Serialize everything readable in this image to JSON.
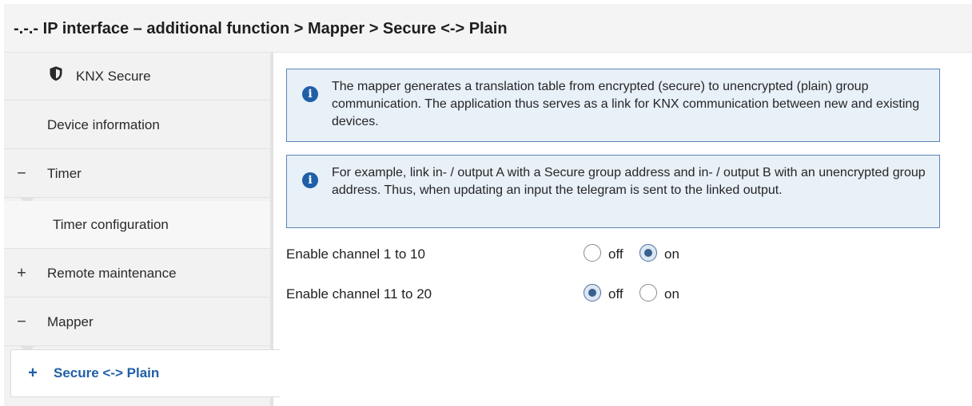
{
  "title": "-.-.- IP interface – additional function > Mapper > Secure <-> Plain",
  "sidebar": {
    "items": [
      {
        "label": "KNX Secure",
        "icon": "shield-icon"
      },
      {
        "label": "Device information"
      },
      {
        "label": "Timer",
        "sign": "−"
      },
      {
        "label": "Timer configuration"
      },
      {
        "label": "Remote maintenance",
        "sign": "+"
      },
      {
        "label": "Mapper",
        "sign": "−"
      },
      {
        "label": "Secure <-> Plain",
        "sign": "+",
        "active": true
      }
    ]
  },
  "info": [
    {
      "icon": "info-icon",
      "text": "The mapper generates a translation table from encrypted (secure) to unencrypted (plain) group communication. The application thus serves as a link for KNX communication between new and existing devices."
    },
    {
      "icon": "info-icon",
      "text": "For example, link in- / output A with a Secure group address and in- / output B with an unencrypted group address. Thus, when updating an input the telegram is sent to the linked output."
    }
  ],
  "params": [
    {
      "label": "Enable channel 1 to 10",
      "options": [
        "off",
        "on"
      ],
      "selected": "on"
    },
    {
      "label": "Enable channel 11 to 20",
      "options": [
        "off",
        "on"
      ],
      "selected": "off"
    }
  ],
  "colors": {
    "accent": "#1f5fa8",
    "info_bg": "#e8f0f8",
    "info_border": "#5a86b8",
    "sidebar_bg": "#f2f2f2"
  }
}
